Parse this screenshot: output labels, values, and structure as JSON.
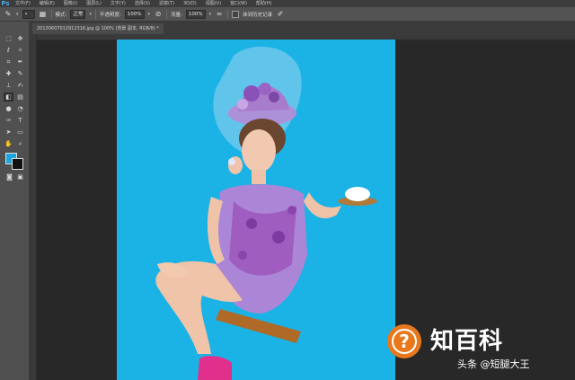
{
  "app": {
    "logo": "Ps"
  },
  "menu": [
    "文件(F)",
    "编辑(E)",
    "图像(I)",
    "图层(L)",
    "文字(Y)",
    "选择(S)",
    "滤镜(T)",
    "3D(D)",
    "视图(V)",
    "窗口(W)",
    "帮助(H)"
  ],
  "options": {
    "mode_label": "模式:",
    "mode_value": "正常",
    "opacity_label": "不透明度:",
    "opacity_value": "100%",
    "flow_label": "流量:",
    "flow_value": "100%",
    "history_label": "抹到历史记录"
  },
  "document": {
    "tab_title": "20130607012912316.jpg @ 100% (背景 副本, RGB/8) *"
  },
  "colors": {
    "canvas_bg": "#1bb2e5",
    "foreground": "#1ba6df",
    "background": "#111111",
    "watermark_orange": "#e8781c"
  },
  "watermark": {
    "brand": "知百科",
    "credit": "头条 @短腿大王"
  },
  "icons": [
    "brush-icon",
    "marquee-tool-icon",
    "move-tool-icon",
    "lasso-tool-icon",
    "crop-tool-icon",
    "eyedropper-tool-icon",
    "healing-tool-icon",
    "brush-tool-icon",
    "stamp-tool-icon",
    "history-brush-icon",
    "eraser-tool-icon",
    "gradient-tool-icon",
    "dodge-tool-icon",
    "pen-tool-icon",
    "type-tool-icon",
    "path-select-icon",
    "shape-tool-icon",
    "hand-tool-icon",
    "zoom-tool-icon"
  ]
}
